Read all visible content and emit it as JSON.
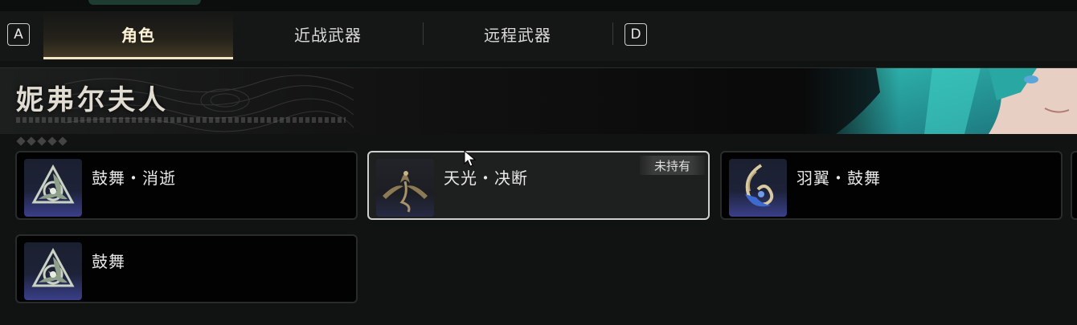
{
  "hotkeys": {
    "left": "A",
    "right": "D"
  },
  "tabs": [
    {
      "label": "角色",
      "active": true
    },
    {
      "label": "近战武器",
      "active": false
    },
    {
      "label": "远程武器",
      "active": false
    }
  ],
  "banner": {
    "title": "妮弗尔夫人"
  },
  "items": [
    {
      "name": "鼓舞・消逝",
      "icon": "triquetra-emblem-icon",
      "owned": true
    },
    {
      "name": "天光・决断",
      "icon": "winged-dragon-icon",
      "owned": false,
      "badge": "未持有"
    },
    {
      "name": "羽翼・鼓舞",
      "icon": "feather-spiral-icon",
      "owned": true
    },
    {
      "name": "鼓舞",
      "icon": "triquetra-emblem-icon",
      "owned": true
    }
  ],
  "colors": {
    "accent": "#f3e7c6",
    "cardBg": "#020202",
    "selectedBorder": "#cfcfcf",
    "iconBlue": "#3a3f8a"
  }
}
